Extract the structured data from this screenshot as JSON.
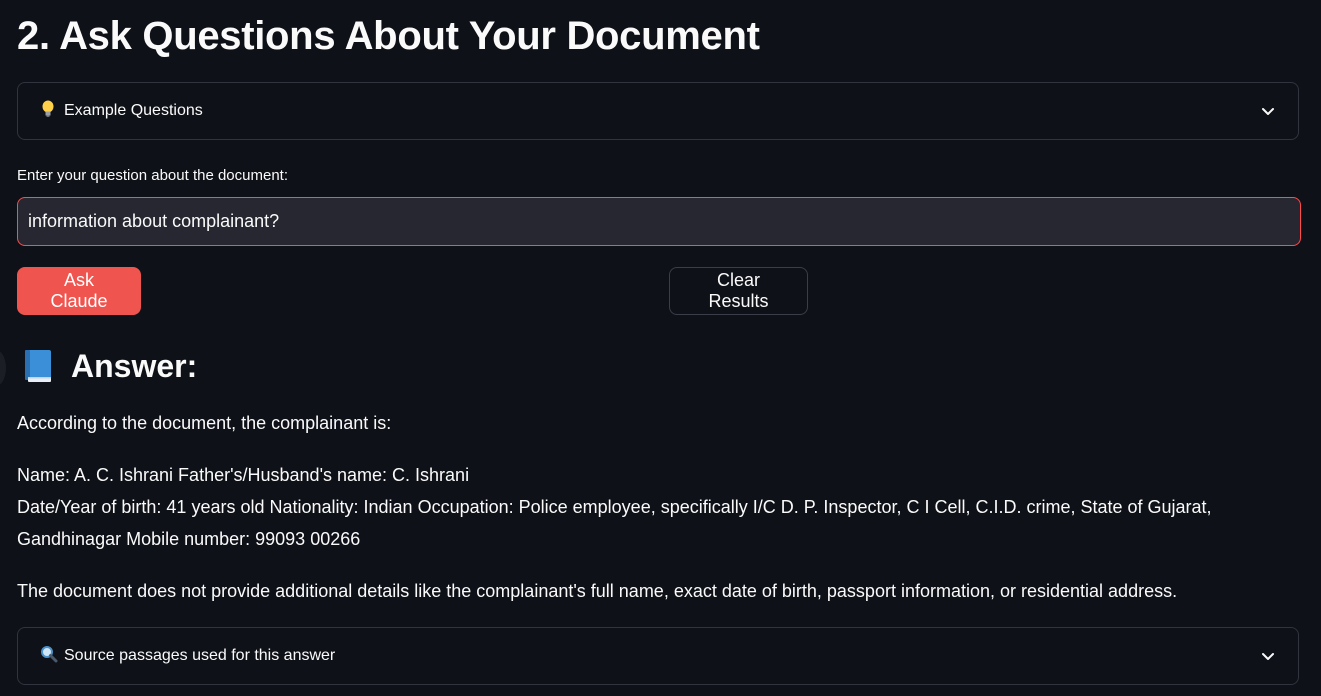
{
  "page": {
    "title": "2. Ask Questions About Your Document"
  },
  "examples": {
    "icon": "lightbulb-icon",
    "label": "Example Questions"
  },
  "question": {
    "label": "Enter your question about the document:",
    "value": "information about complainant?"
  },
  "buttons": {
    "ask_label": "Ask Claude",
    "clear_label": "Clear Results"
  },
  "answer": {
    "icon": "book-icon",
    "heading": "Answer:",
    "intro": "According to the document, the complainant is:",
    "line1": "Name: A. C. Ishrani Father's/Husband's name: C. Ishrani",
    "line2": "Date/Year of birth: 41 years old Nationality: Indian Occupation: Police employee, specifically I/C D. P. Inspector, C I Cell, C.I.D. crime, State of Gujarat,",
    "line3": "Gandhinagar Mobile number: 99093 00266",
    "note": "The document does not provide additional details like the complainant's full name, exact date of birth, passport information, or residential address."
  },
  "sources": {
    "icon": "magnifier-icon",
    "label": "Source passages used for this answer"
  },
  "colors": {
    "background": "#0e1117",
    "primary": "#f0544f",
    "input_border": "#ff4b4b",
    "border": "#31333f"
  }
}
